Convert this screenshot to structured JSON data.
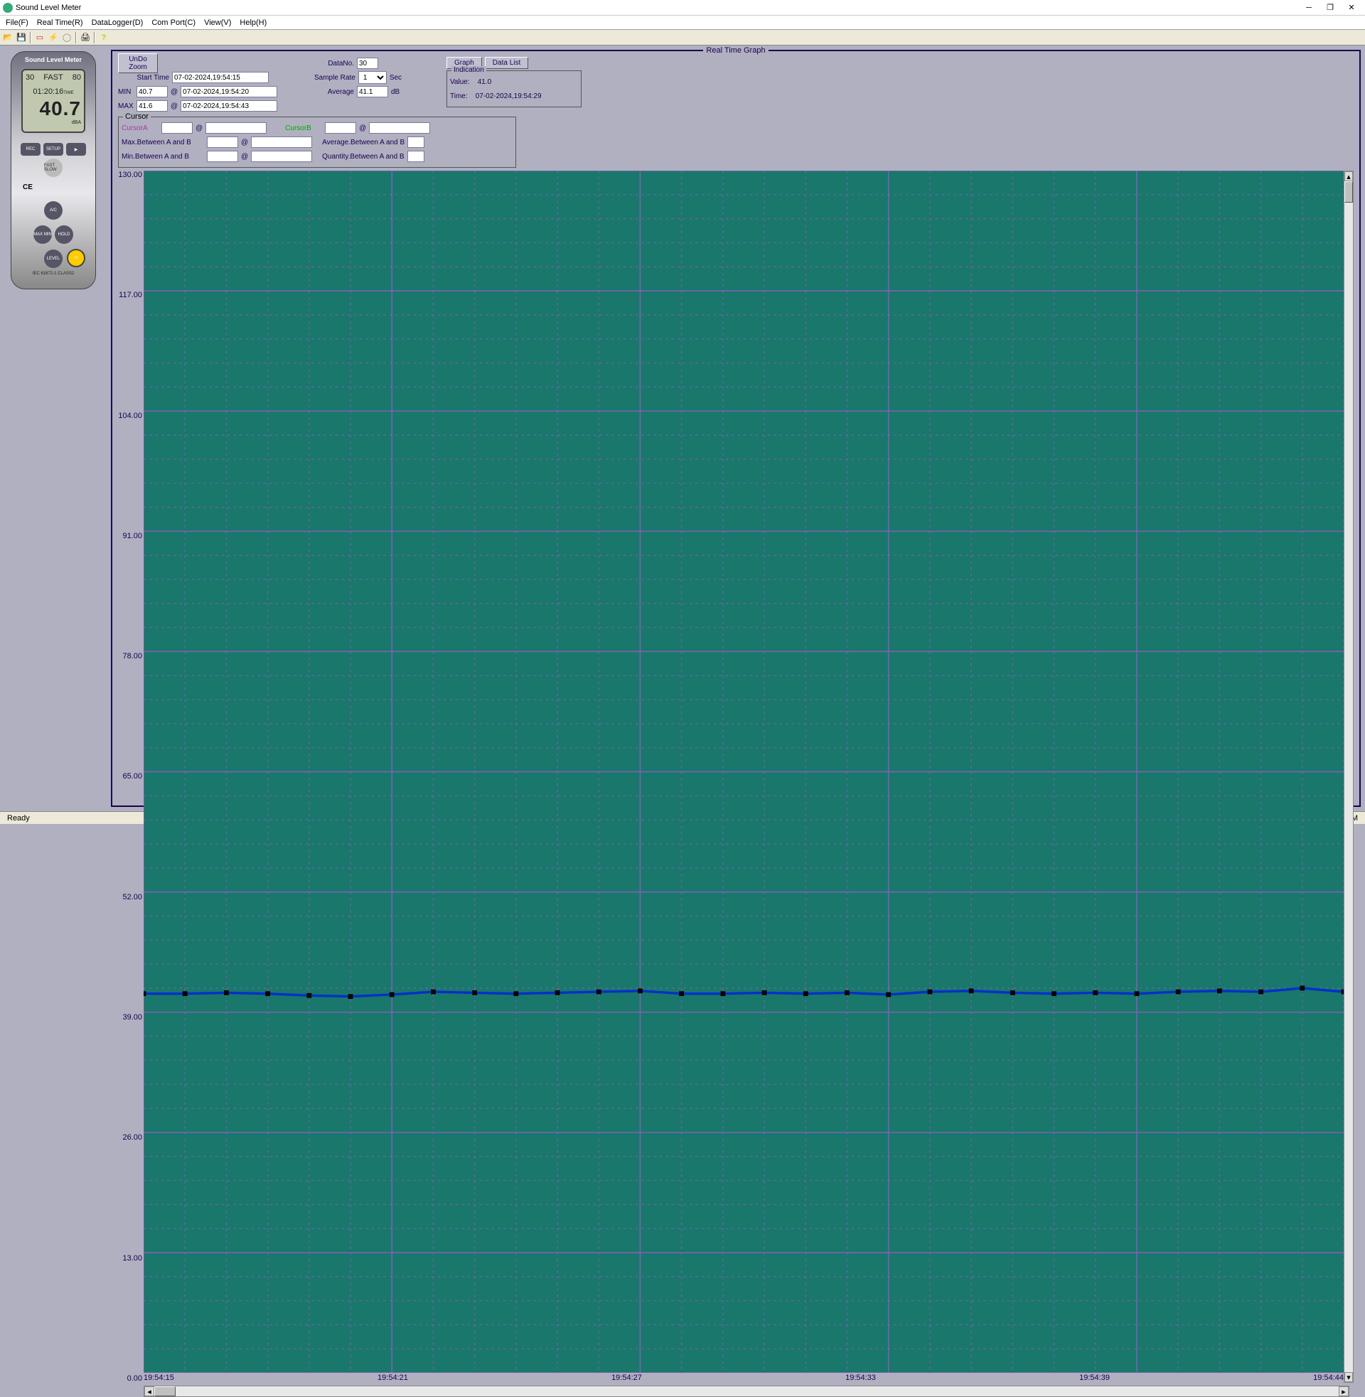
{
  "window": {
    "title": "Sound Level Meter"
  },
  "menu": {
    "file": "File(F)",
    "realtime": "Real Time(R)",
    "datalogger": "DataLogger(D)",
    "comport": "Com Port(C)",
    "view": "View(V)",
    "help": "Help(H)"
  },
  "device": {
    "label": "Sound Level Meter",
    "range_lo": "30",
    "range_hi": "80",
    "mode": "FAST",
    "time": "01:20:16",
    "time_suffix": "TIME",
    "reading": "40.7",
    "unit": "dBA",
    "btns": {
      "rec": "REC",
      "setup": "SETUP",
      "arrow": "▶",
      "fastslow": "FAST SLOW",
      "ac": "A/C",
      "maxmin": "MAX MIN",
      "hold": "HOLD",
      "level": "LEVEL"
    },
    "ce": "CE",
    "bottom": "IEC 61672-1 CLASS2"
  },
  "panel": {
    "title": "Real Time Graph",
    "undo": "UnDo Zoom",
    "start_time_lbl": "Start Time",
    "start_time": "07-02-2024,19:54:15",
    "min_lbl": "MIN",
    "min_val": "40.7",
    "min_time": "07-02-2024,19:54:20",
    "max_lbl": "MAX",
    "max_val": "41.6",
    "max_time": "07-02-2024,19:54:43",
    "at": "@",
    "datano_lbl": "DataNo.",
    "datano": "30",
    "samplerate_lbl": "Sample Rate",
    "samplerate": "1",
    "sec": "Sec",
    "average_lbl": "Average",
    "average": "41.1",
    "db": "dB",
    "graph_btn": "Graph",
    "datalist_btn": "Data List",
    "indication_lbl": "Indication",
    "value_lbl": "Value:",
    "value": "41.0",
    "time_lbl": "Time:",
    "time": "07-02-2024,19:54:29"
  },
  "cursor": {
    "title": "Cursor",
    "cursorA": "CursorA",
    "cursorB": "CursorB",
    "maxAB": "Max.Between A and B",
    "minAB": "Min.Between A and B",
    "avgAB": "Average.Between A and B",
    "qtyAB": "Quantity.Between A and B"
  },
  "chart_data": {
    "type": "line",
    "ylim": [
      0,
      130
    ],
    "y_ticks": [
      "130.00",
      "117.00",
      "104.00",
      "91.00",
      "78.00",
      "65.00",
      "52.00",
      "39.00",
      "26.00",
      "13.00",
      "0.00"
    ],
    "x_ticks": [
      "19:54:15",
      "19:54:21",
      "19:54:27",
      "19:54:33",
      "19:54:39",
      "19:54:44"
    ],
    "x": [
      "19:54:15",
      "19:54:16",
      "19:54:17",
      "19:54:18",
      "19:54:19",
      "19:54:20",
      "19:54:21",
      "19:54:22",
      "19:54:23",
      "19:54:24",
      "19:54:25",
      "19:54:26",
      "19:54:27",
      "19:54:28",
      "19:54:29",
      "19:54:30",
      "19:54:31",
      "19:54:32",
      "19:54:33",
      "19:54:34",
      "19:54:35",
      "19:54:36",
      "19:54:37",
      "19:54:38",
      "19:54:39",
      "19:54:40",
      "19:54:41",
      "19:54:42",
      "19:54:43",
      "19:54:44"
    ],
    "values": [
      41.0,
      41.0,
      41.1,
      41.0,
      40.8,
      40.7,
      40.9,
      41.2,
      41.1,
      41.0,
      41.1,
      41.2,
      41.3,
      41.0,
      41.0,
      41.1,
      41.0,
      41.1,
      40.9,
      41.2,
      41.3,
      41.1,
      41.0,
      41.1,
      41.0,
      41.2,
      41.3,
      41.2,
      41.6,
      41.2
    ]
  },
  "status": {
    "ready": "Ready",
    "num": "NUM"
  }
}
